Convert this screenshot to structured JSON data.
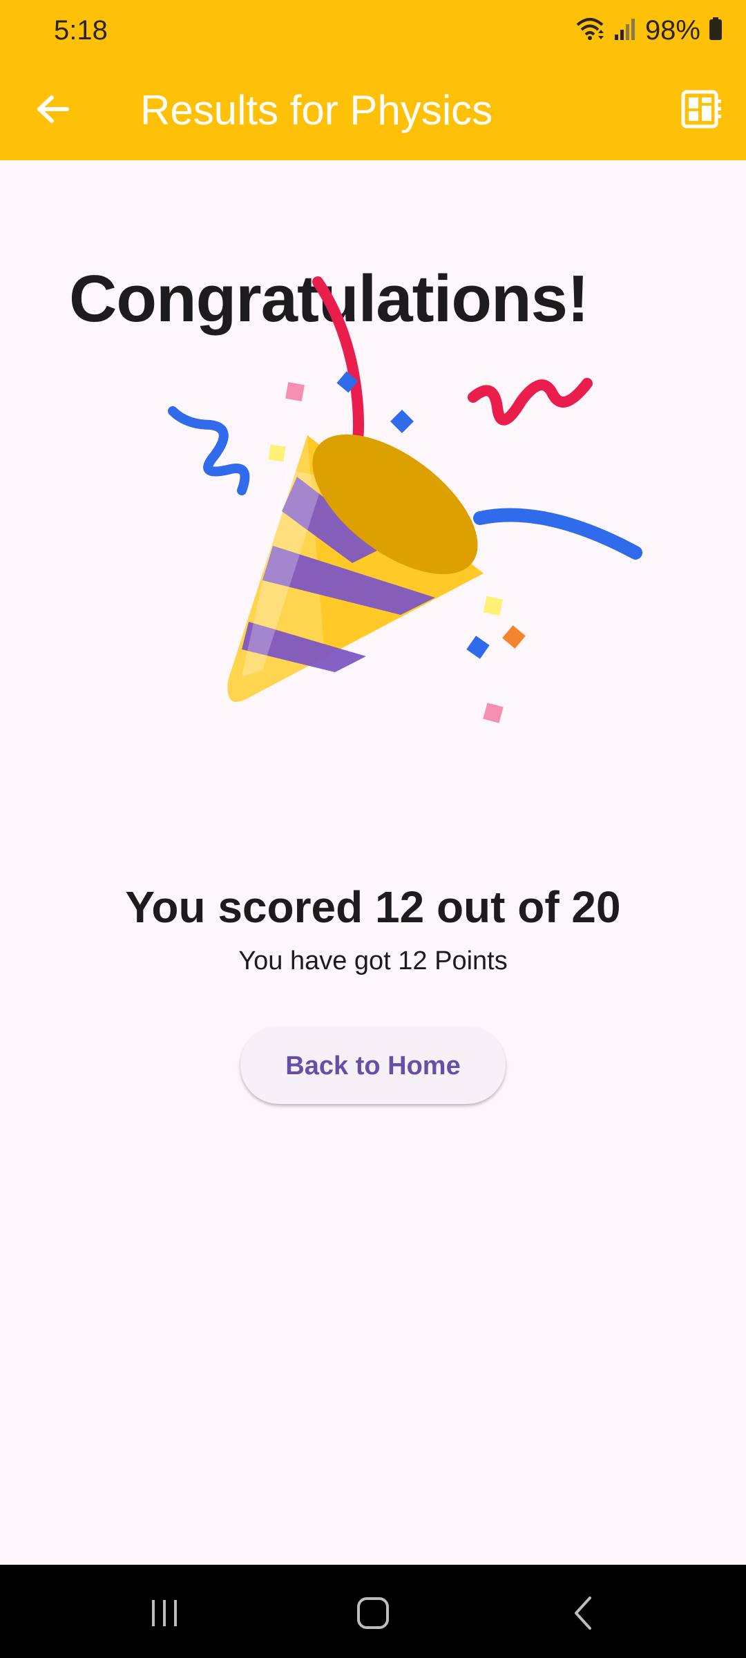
{
  "status_bar": {
    "time": "5:18",
    "battery_percent": "98%",
    "icons": [
      "wifi-icon",
      "signal-icon",
      "battery-icon"
    ]
  },
  "app_bar": {
    "back_icon": "arrow-left-icon",
    "title": "Results for Physics",
    "action_icon": "dashboard-icon",
    "background_color": "#ffc107"
  },
  "result": {
    "heading": "Congratulations!",
    "illustration": "party-popper-icon",
    "score_text": "You scored 12 out of 20",
    "score": 12,
    "total": 20,
    "points_text": "You have got 12 Points",
    "home_button_label": "Back to Home"
  },
  "colors": {
    "accent": "#ffc107",
    "button_text": "#6750a4",
    "background": "#fdf7fc"
  },
  "nav_bar": {
    "icons": [
      "recent-apps-icon",
      "home-icon",
      "back-icon"
    ]
  }
}
